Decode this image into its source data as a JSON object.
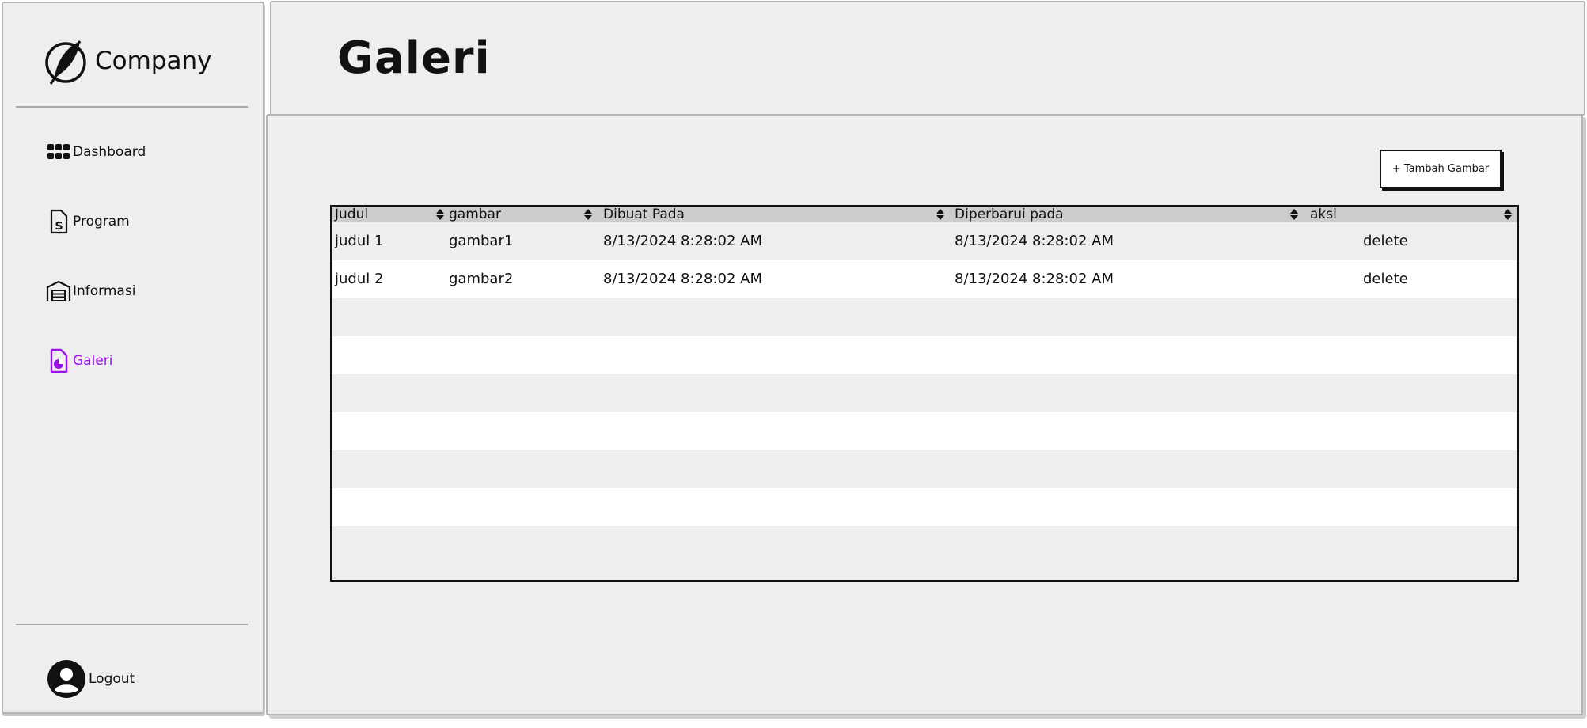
{
  "brand": {
    "name": "Company"
  },
  "sidebar": {
    "items": [
      {
        "label": "Dashboard",
        "icon": "dashboard-grid-icon"
      },
      {
        "label": "Program",
        "icon": "invoice-dollar-icon"
      },
      {
        "label": "Informasi",
        "icon": "warehouse-icon"
      },
      {
        "label": "Galeri",
        "icon": "image-file-icon",
        "active": true
      }
    ],
    "logout_label": "Logout"
  },
  "page": {
    "title": "Galeri"
  },
  "toolbar": {
    "add_label": "+ Tambah Gambar"
  },
  "table": {
    "columns": [
      "Judul",
      "gambar",
      "Dibuat Pada",
      "Diperbarui pada",
      "aksi"
    ],
    "rows": [
      [
        "judul 1",
        "gambar1",
        "8/13/2024 8:28:02 AM",
        "8/13/2024 8:28:02 AM",
        "delete"
      ],
      [
        "judul 2",
        "gambar2",
        "8/13/2024 8:28:02 AM",
        "8/13/2024 8:28:02 AM",
        "delete"
      ]
    ]
  },
  "colors": {
    "accent": "#9b12e8",
    "panel": "#eeeeee",
    "header_row": "#cccccc"
  }
}
